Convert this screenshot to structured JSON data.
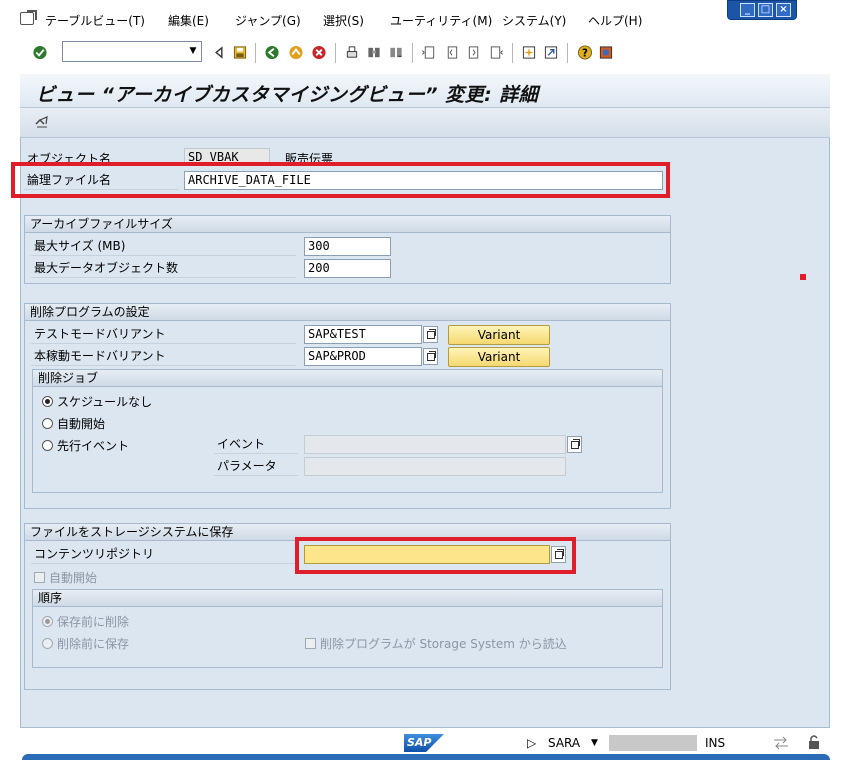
{
  "menu": {
    "items": [
      {
        "label": "テーブルビュー(T)"
      },
      {
        "label": "編集(E)"
      },
      {
        "label": "ジャンプ(G)"
      },
      {
        "label": "選択(S)"
      },
      {
        "label": "ユーティリティ(M)"
      },
      {
        "label": "システム(Y)"
      },
      {
        "label": "ヘルプ(H)"
      }
    ]
  },
  "window_controls": {
    "minimize": "_",
    "maximize": "□",
    "close": "×"
  },
  "toolbar": {
    "command_field_value": "",
    "icons": [
      "enter-icon",
      "back-arrow-icon",
      "save-icon",
      "back-icon",
      "exit-icon",
      "cancel-icon",
      "print-icon",
      "find-icon",
      "find-next-icon",
      "first-page-icon",
      "prev-page-icon",
      "next-page-icon",
      "last-page-icon",
      "create-session-icon",
      "shortcut-icon",
      "help-icon",
      "layout-icon"
    ]
  },
  "header": {
    "title": "ビュー “アーカイブカスタマイジングビュー” 変更: 詳細"
  },
  "form": {
    "object_name_label": "オブジェクト名",
    "object_name_value": "SD_VBAK",
    "object_desc": "販売伝票",
    "logical_file_label": "論理ファイル名",
    "logical_file_value": "ARCHIVE_DATA_FILE"
  },
  "archive_size": {
    "title": "アーカイブファイルサイズ",
    "max_size_label": "最大サイズ (MB)",
    "max_size_value": "300",
    "max_objects_label": "最大データオブジェクト数",
    "max_objects_value": "200"
  },
  "delete_program": {
    "title": "削除プログラムの設定",
    "test_variant_label": "テストモードバリアント",
    "test_variant_value": "SAP&TEST",
    "prod_variant_label": "本稼動モードバリアント",
    "prod_variant_value": "SAP&PROD",
    "variant_button": "Variant",
    "jobs": {
      "title": "削除ジョブ",
      "options": [
        {
          "label": "スケジュールなし",
          "selected": true
        },
        {
          "label": "自動開始",
          "selected": false
        },
        {
          "label": "先行イベント",
          "selected": false
        }
      ],
      "event_label": "イベント",
      "event_value": "",
      "param_label": "パラメータ",
      "param_value": ""
    }
  },
  "storage": {
    "title": "ファイルをストレージシステムに保存",
    "content_repo_label": "コンテンツリポジトリ",
    "content_repo_value": "",
    "auto_start_label": "自動開始",
    "sequence": {
      "title": "順序",
      "options": [
        {
          "label": "保存前に削除",
          "selected": true
        },
        {
          "label": "削除前に保存",
          "selected": false
        }
      ],
      "read_from_storage_label": "削除プログラムが Storage System から読込"
    }
  },
  "status": {
    "sap_logo": "SAP",
    "transaction": "SARA",
    "mode": "INS"
  }
}
